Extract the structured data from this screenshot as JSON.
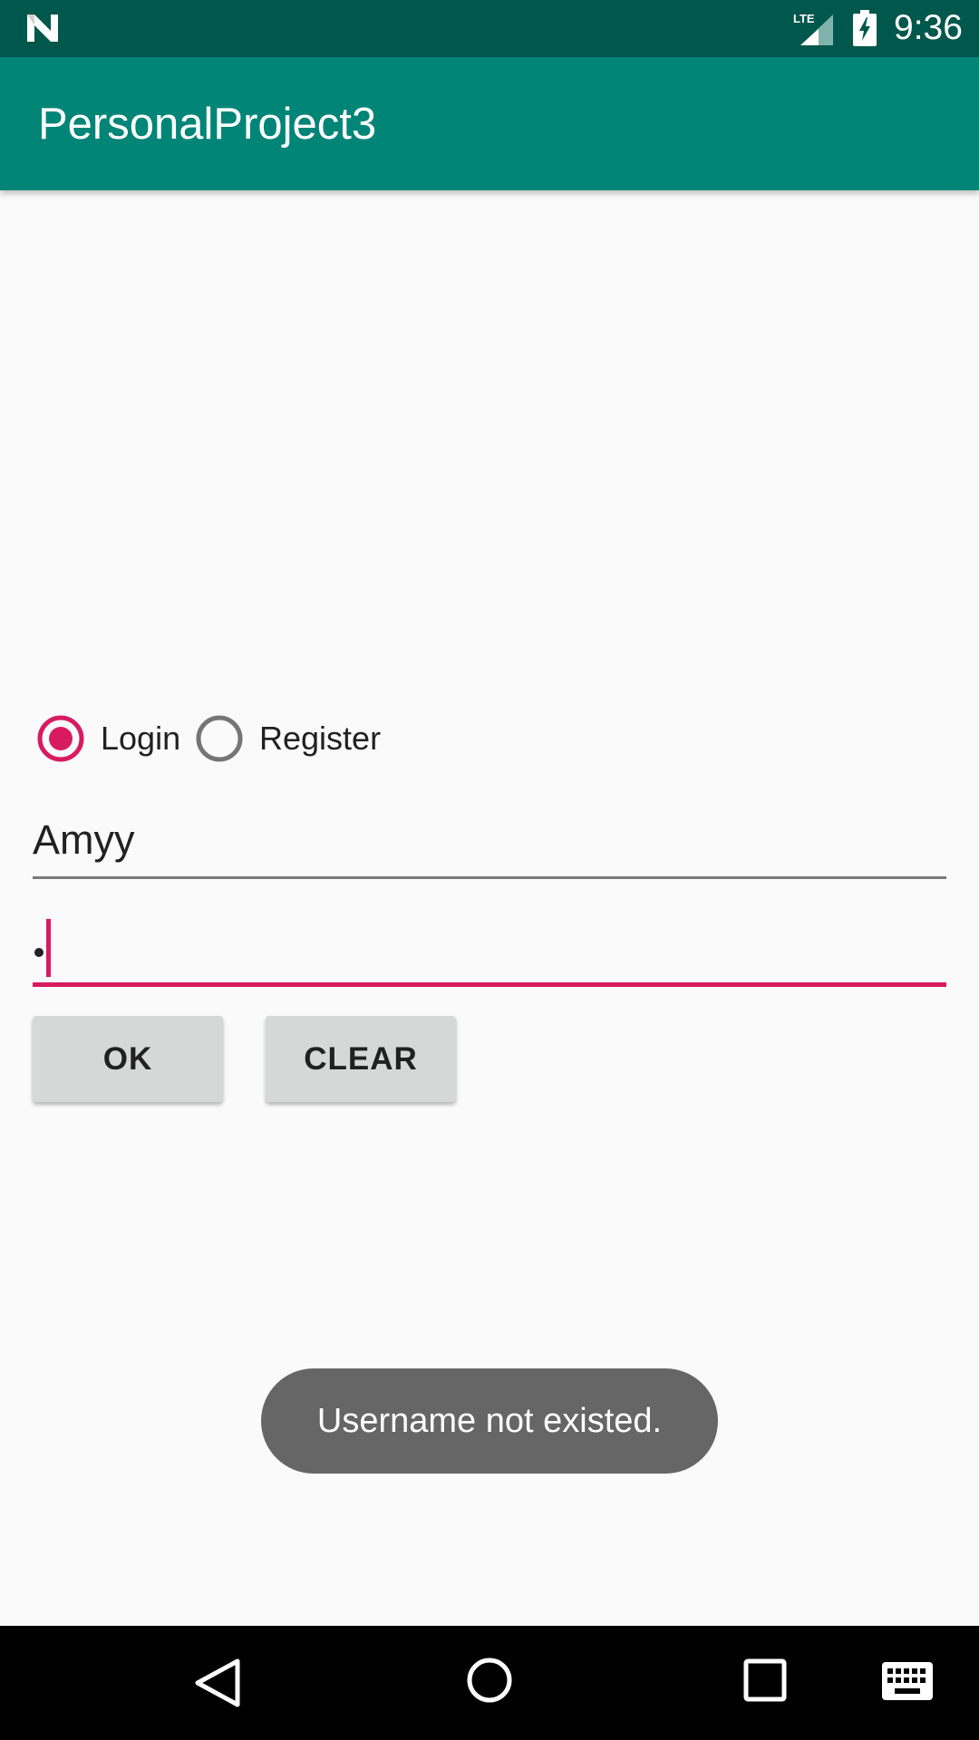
{
  "status_bar": {
    "time": "9:36",
    "network_label": "LTE",
    "icons": [
      "android-n-icon",
      "lte-signal-icon",
      "battery-charging-icon"
    ]
  },
  "app_bar": {
    "title": "PersonalProject3",
    "color": "#008577",
    "status_color": "#00574b"
  },
  "radio_group": {
    "options": [
      {
        "label": "Login",
        "checked": true
      },
      {
        "label": "Register",
        "checked": false
      }
    ]
  },
  "form": {
    "username_value": "Amyy",
    "password_value": "•",
    "accent_color": "#d81b60"
  },
  "buttons": {
    "ok_label": "OK",
    "clear_label": "CLEAR"
  },
  "toast": {
    "message": "Username not existed."
  },
  "nav_bar": {
    "icons": [
      "back-icon",
      "home-icon",
      "recents-icon",
      "keyboard-icon"
    ]
  }
}
